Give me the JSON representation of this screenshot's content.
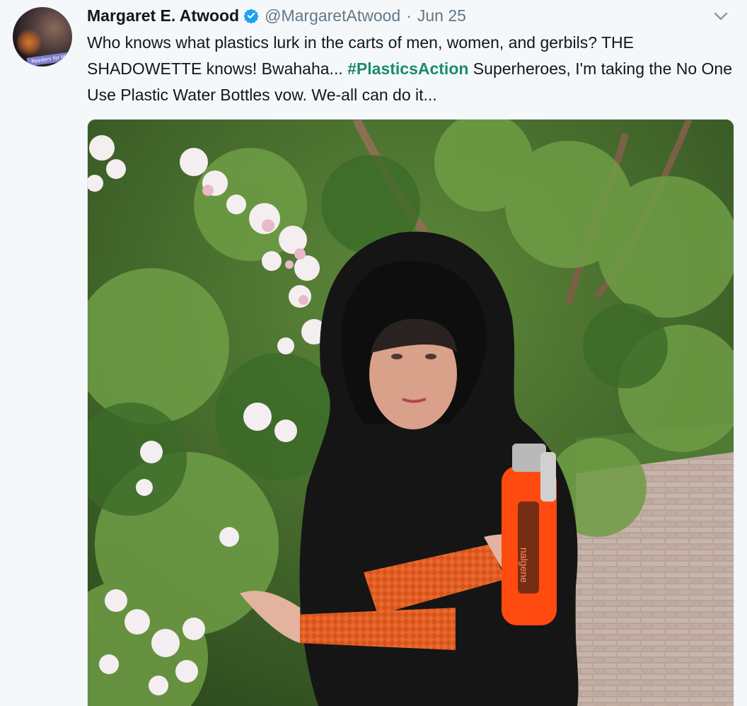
{
  "tweet": {
    "author_name": "Margaret E. Atwood",
    "handle": "@MargaretAtwood",
    "separator": "·",
    "date": "Jun 25",
    "text_before": "Who knows what plastics lurk in the carts of men, women, and gerbils? THE SHADOWETTE knows!  Bwahaha... ",
    "hashtag": "#PlasticsAction",
    "text_after": " Superheroes, I'm taking the No One Use Plastic Water Bottles vow. We-all can do it..."
  },
  "avatar": {
    "caption": "Readers for M"
  },
  "photo": {
    "bottle_label": "nalgene"
  },
  "colors": {
    "hashtag": "#1a8b6e",
    "verified": "#1da1f2",
    "cloak": "#151515",
    "gloves": "#d9531e",
    "bottle": "#ff4a10"
  },
  "icons": {
    "verified": "verified-badge-icon",
    "menu": "chevron-down-icon"
  }
}
